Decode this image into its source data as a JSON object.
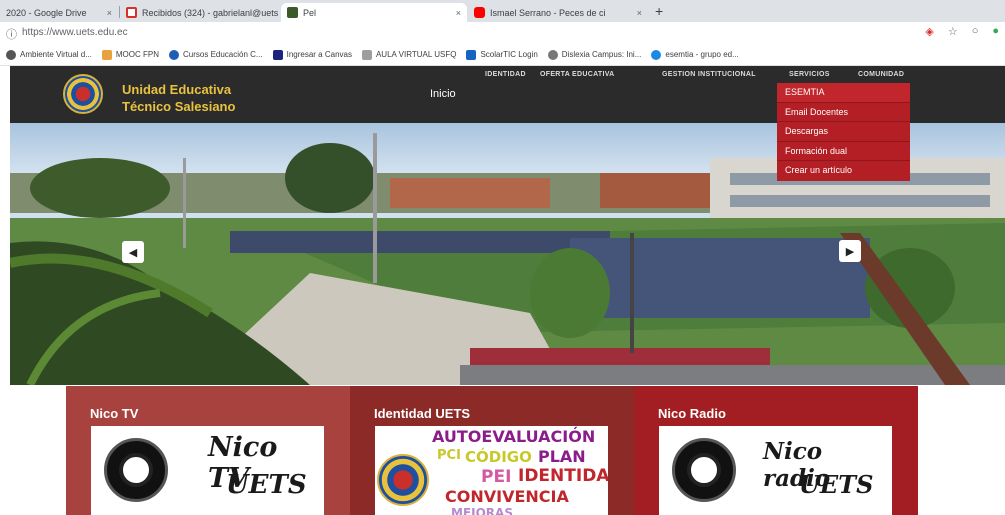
{
  "browser": {
    "tabs": [
      {
        "title": "2020 - Google Drive",
        "close": "×"
      },
      {
        "title": "Recibidos (324) - gabrielanl@uets",
        "close": "×"
      },
      {
        "title": "Pel",
        "close": "×"
      },
      {
        "title": "Ismael Serrano - Peces de ci",
        "close": "×"
      }
    ],
    "new_tab": "+",
    "url": "https://www.uets.edu.ec",
    "bookmarks": [
      "Ambiente Virtual d...",
      "MOOC FPN",
      "Cursos Educación C...",
      "Ingresar a Canvas",
      "AULA VIRTUAL USFQ",
      "ScolarTIC Login",
      "Dislexia Campus: Ini...",
      "esemtia - grupo ed..."
    ]
  },
  "site": {
    "school_name_line1": "Unidad Educativa",
    "school_name_line2": "Técnico Salesiano",
    "inicio": "Inicio",
    "nav": [
      "IDENTIDAD",
      "OFERTA EDUCATIVA",
      "GESTION INSTITUCIONAL",
      "SERVICIOS",
      "COMUNIDAD"
    ],
    "dropdown": [
      "ESEMTIA",
      "Email Docentes",
      "Descargas",
      "Formación dual",
      "Crear un artículo"
    ],
    "prev_arrow": "◀",
    "next_arrow": "▶"
  },
  "panels": [
    {
      "title": "Nico TV",
      "script_line1": "Nico TV",
      "script_line2": "UETS",
      "badge_text": "NICO TV"
    },
    {
      "title": "Identidad UETS",
      "words": [
        "AUTOEVALUACIÓN",
        "PCI",
        "CÓDIGO",
        "PLAN",
        "PEI",
        "IDENTIDAD",
        "CONVIVENCIA",
        "MEJORAS"
      ]
    },
    {
      "title": "Nico Radio",
      "script_line1": "Nico radio",
      "script_line2": "UETS",
      "badge_text": "NICO RADIO"
    }
  ],
  "colors": {
    "header_bg": "#2b2b2b",
    "brand_gold": "#e9c33f",
    "dropdown_red": "#b31f24",
    "panel1": "#a8423f",
    "panel2": "#8c2a28",
    "panel3": "#a31e22"
  }
}
